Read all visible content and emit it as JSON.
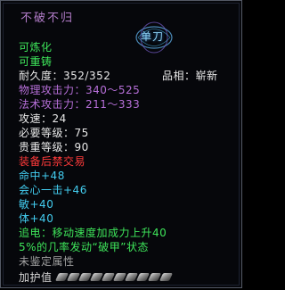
{
  "item": {
    "name": "不破不归",
    "emblem_label": "单刀",
    "refinable": "可炼化",
    "recastable": "可重铸",
    "durability": "耐久度：352/352",
    "quality": "品相：崭新",
    "phys_attack": "物理攻击力：340～525",
    "magic_attack": "法术攻击力：211～333",
    "attack_speed": "攻速：24",
    "required_level": "必要等级：75",
    "prestige_level": "贵重等级：90",
    "trade_note": "装备后禁交易",
    "bonus_hit": "命中+48",
    "bonus_critical": "会心一击+46",
    "bonus_agility": "敏+40",
    "bonus_physique": "体+40",
    "chase_effect": "追电：移动速度加成力上升40",
    "break_armor": "5%的几率发动“破甲”状态",
    "unidentified": "未鉴定属性",
    "armor_label": "加护值",
    "armor_segments": 10
  },
  "colors": {
    "green": "#3ee55a",
    "purple": "#b66fd8",
    "red": "#ff3a3a",
    "cyan": "#43cdf0",
    "title": "#b27cc9"
  }
}
